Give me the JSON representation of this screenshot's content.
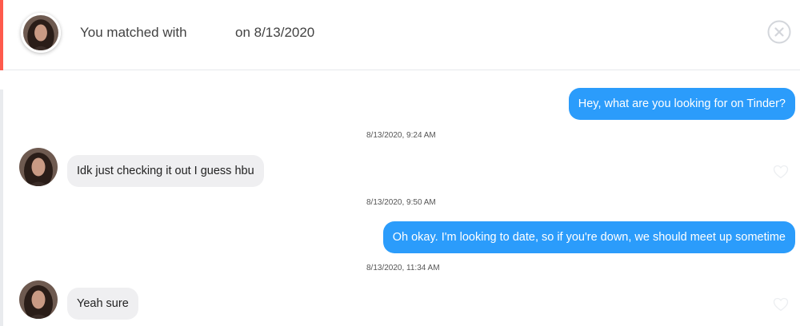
{
  "header": {
    "match_prefix": "You matched with",
    "match_date": "on 8/13/2020",
    "close_icon": "close-circle-icon",
    "avatar": "match-avatar"
  },
  "messages": [
    {
      "direction": "outgoing",
      "text": "Hey, what are you looking for on Tinder?"
    },
    {
      "timestamp": "8/13/2020, 9:24 AM"
    },
    {
      "direction": "incoming",
      "text": "Idk just checking it out I guess hbu",
      "like_icon": "heart-outline-icon"
    },
    {
      "timestamp": "8/13/2020, 9:50 AM"
    },
    {
      "direction": "outgoing",
      "text": "Oh okay. I'm looking to date, so if you're down, we should meet up sometime"
    },
    {
      "timestamp": "8/13/2020, 11:34 AM"
    },
    {
      "direction": "incoming",
      "text": "Yeah sure",
      "like_icon": "heart-outline-icon"
    }
  ],
  "colors": {
    "accent": "#fe5a4c",
    "outgoing_bubble": "#2b9cfb",
    "incoming_bubble": "#efeff1"
  }
}
